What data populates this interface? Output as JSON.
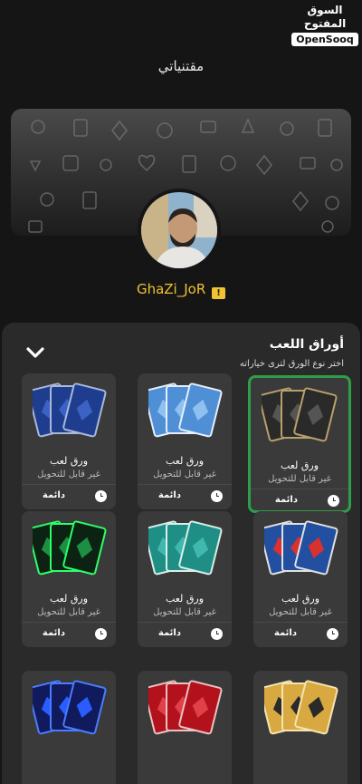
{
  "watermark": {
    "arabic": "السوق المفتوح",
    "english": "OpenSooq"
  },
  "page": {
    "title": "مقتنياتي"
  },
  "profile": {
    "username": "GhaZi_JoR",
    "warning_glyph": "!"
  },
  "sheet": {
    "title": "أوراق اللعب",
    "subtitle": "اختر نوع الورق لترى خياراته"
  },
  "cards": [
    {
      "name": "ورق لعب",
      "note": "غير قابل للتحويل",
      "duration": "دائمة",
      "theme": "black",
      "selected": true
    },
    {
      "name": "ورق لعب",
      "note": "غير قابل للتحويل",
      "duration": "دائمة",
      "theme": "light-blue",
      "selected": false
    },
    {
      "name": "ورق لعب",
      "note": "غير قابل للتحويل",
      "duration": "دائمة",
      "theme": "navy",
      "selected": false
    },
    {
      "name": "ورق لعب",
      "note": "غير قابل للتحويل",
      "duration": "دائمة",
      "theme": "blue-red",
      "selected": false
    },
    {
      "name": "ورق لعب",
      "note": "غير قابل للتحويل",
      "duration": "دائمة",
      "theme": "teal",
      "selected": false
    },
    {
      "name": "ورق لعب",
      "note": "غير قابل للتحويل",
      "duration": "دائمة",
      "theme": "neon-green",
      "selected": false
    },
    {
      "name": "",
      "note": "",
      "duration": "",
      "theme": "gold",
      "selected": false
    },
    {
      "name": "",
      "note": "",
      "duration": "",
      "theme": "red",
      "selected": false
    },
    {
      "name": "",
      "note": "",
      "duration": "",
      "theme": "neon-blue",
      "selected": false
    }
  ]
}
